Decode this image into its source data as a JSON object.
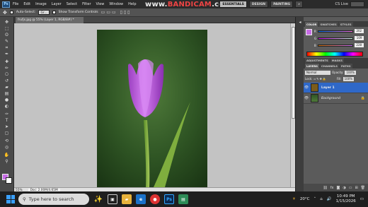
{
  "menubar": {
    "logo": "Ps",
    "items": [
      "File",
      "Edit",
      "Image",
      "Layer",
      "Select",
      "Filter",
      "View",
      "Window",
      "Help"
    ]
  },
  "watermark": {
    "prefix": "www.",
    "brand": "BANDICAM",
    "suffix": ".com"
  },
  "workspace": {
    "buttons": [
      "ESSENTIALS",
      "DESIGN",
      "PAINTING"
    ],
    "more": "»",
    "cs_live": "CS Live"
  },
  "options": {
    "auto_select": "Auto-Select:",
    "auto_select_value": "Gr...",
    "transform": "Show Transform Controls"
  },
  "document": {
    "tab_label": "frufjs.jpg @ 55% (Layer 1, RGB/8#) *",
    "zoom": "55%",
    "doc_info": "Doc: 2.00M/4.65M"
  },
  "tools": [
    "move-tool",
    "marquee-tool",
    "lasso-tool",
    "quick-select-tool",
    "crop-tool",
    "eyedropper-tool",
    "healing-tool",
    "brush-tool",
    "clone-tool",
    "history-brush-tool",
    "eraser-tool",
    "gradient-tool",
    "blur-tool",
    "dodge-tool",
    "pen-tool",
    "type-tool",
    "path-select-tool",
    "shape-tool",
    "3d-rotate-tool",
    "3d-orbit-tool",
    "hand-tool",
    "zoom-tool"
  ],
  "color_panel": {
    "tabs": [
      "COLOR",
      "SWATCHES",
      "STYLES"
    ],
    "channels": [
      {
        "label": "R",
        "value": "202"
      },
      {
        "label": "G",
        "value": "109"
      },
      {
        "label": "B",
        "value": "228"
      }
    ],
    "fg_color": "#ca6de4"
  },
  "layers_panel": {
    "tabs": [
      "LAYERS",
      "CHANNELS",
      "PATHS"
    ],
    "left_tabs": [
      "ADJUSTMENTS",
      "MASKS"
    ],
    "blend_mode": "Normal",
    "opacity_label": "Opacity:",
    "opacity": "100%",
    "lock_label": "Lock:",
    "fill_label": "Fill:",
    "fill": "100%",
    "layers": [
      {
        "name": "Layer 1",
        "selected": true
      },
      {
        "name": "Background",
        "selected": false
      }
    ]
  },
  "taskbar": {
    "search_placeholder": "Type here to search",
    "weather": "20°C",
    "time": "10:49 PM",
    "date": "1/15/2026"
  }
}
